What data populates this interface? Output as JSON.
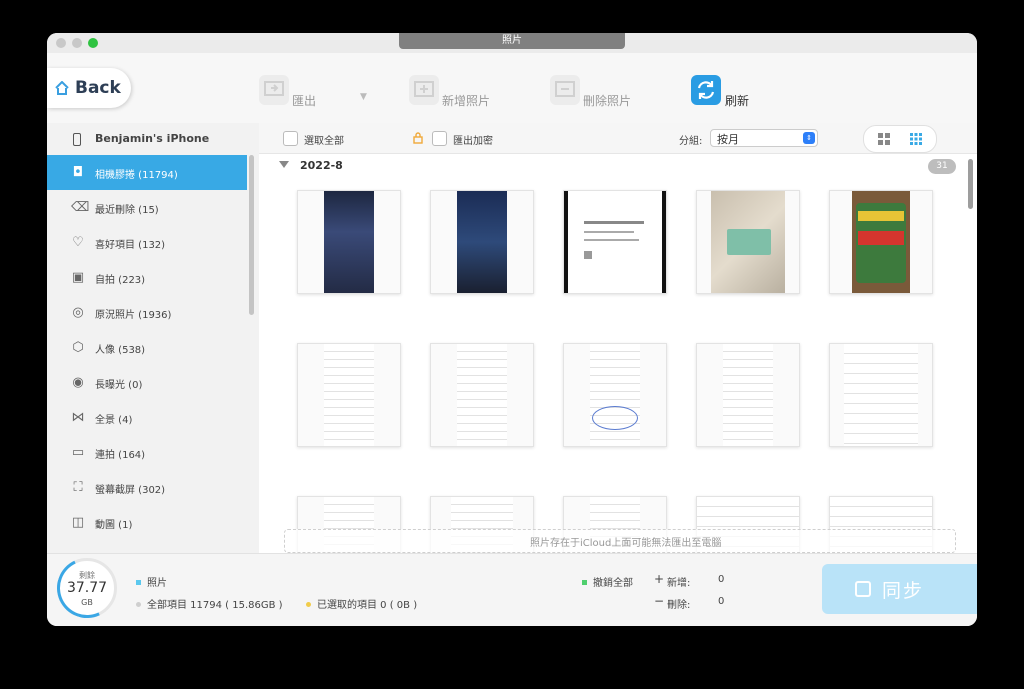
{
  "window": {
    "title": "照片"
  },
  "toolbar": {
    "back_label": "Back",
    "export_label": "匯出",
    "add_label": "新增照片",
    "delete_label": "刪除照片",
    "refresh_label": "刷新"
  },
  "sidebar": {
    "device_name": "Benjamin's iPhone",
    "items": [
      {
        "label": "相機膠捲 (11794)",
        "icon": "camera-icon"
      },
      {
        "label": "最近刪除 (15)",
        "icon": "trash-icon"
      },
      {
        "label": "喜好項目 (132)",
        "icon": "heart-icon"
      },
      {
        "label": "自拍 (223)",
        "icon": "selfie-icon"
      },
      {
        "label": "原況照片 (1936)",
        "icon": "live-photo-icon"
      },
      {
        "label": "人像 (538)",
        "icon": "cube-icon"
      },
      {
        "label": "長曝光 (0)",
        "icon": "long-exposure-icon"
      },
      {
        "label": "全景 (4)",
        "icon": "panorama-icon"
      },
      {
        "label": "連拍 (164)",
        "icon": "burst-icon"
      },
      {
        "label": "螢幕截屏 (302)",
        "icon": "screenshot-icon"
      },
      {
        "label": "動圖 (1)",
        "icon": "animated-icon"
      }
    ]
  },
  "filter": {
    "select_all": "選取全部",
    "export_encrypted": "匯出加密",
    "group_label": "分組:",
    "group_value": "按月"
  },
  "gallery": {
    "date_label": "2022-8",
    "count": "31",
    "icloud_note": "照片存在于iCloud上面可能無法匯出至電腦"
  },
  "footer": {
    "storage_label": "剩餘",
    "storage_value": "37.77",
    "storage_unit": "GB",
    "category": "照片",
    "total_items": "全部項目 11794 ( 15.86GB )",
    "selected_items": "已選取的項目 0 ( 0B )",
    "undo_all": "撤銷全部",
    "added_label": "新增:",
    "added_value": "0",
    "deleted_label": "刪除:",
    "deleted_value": "0",
    "sync_label": "同步"
  },
  "colors": {
    "accent": "#38a9e5",
    "sync": "#b9e3f8"
  }
}
